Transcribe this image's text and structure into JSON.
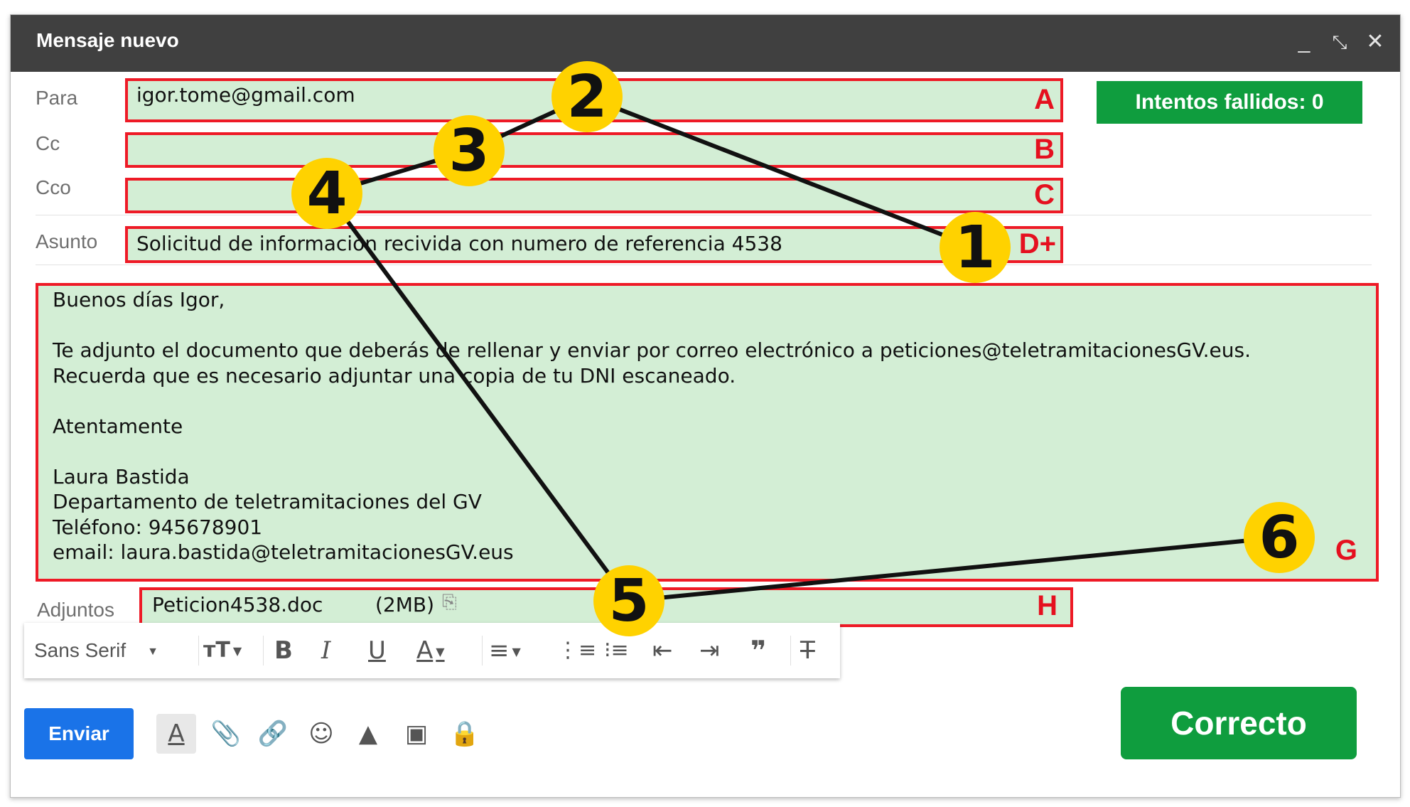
{
  "window": {
    "title": "Mensaje nuevo",
    "controls": {
      "minimize": "_",
      "expand": "⤡",
      "close": "✕"
    }
  },
  "fields": {
    "to": {
      "label": "Para",
      "value": "igor.tome@gmail.com",
      "letter": "A"
    },
    "cc": {
      "label": "Cc",
      "value": "",
      "letter": "B"
    },
    "bcc": {
      "label": "Cco",
      "value": "",
      "letter": "C"
    },
    "subject": {
      "label": "Asunto",
      "value": "Solicitud de informacion recivida con numero de referencia 4538",
      "letter": "D+"
    },
    "attachments": {
      "label": "Adjuntos",
      "file_name": "Peticion4538.doc",
      "file_size": "(2MB)",
      "letter": "H"
    }
  },
  "body": {
    "letter": "G",
    "lines": [
      "Buenos días Igor,",
      "",
      "Te adjunto el documento que deberás de rellenar y enviar por correo electrónico a peticiones@teletramitacionesGV.eus.",
      "Recuerda que es necesario adjuntar una copia de tu DNI escaneado.",
      "",
      "Atentamente",
      "",
      "Laura Bastida",
      "Departamento de teletramitaciones del GV",
      "Teléfono: 945678901",
      "email: laura.bastida@teletramitacionesGV.eus"
    ]
  },
  "status": {
    "failed_attempts": "Intentos fallidos: 0"
  },
  "toolbar": {
    "font": "Sans Serif",
    "icons": [
      "text-size-icon",
      "bold-icon",
      "italic-icon",
      "underline-icon",
      "text-color-icon",
      "align-icon",
      "numbered-list-icon",
      "bulleted-list-icon",
      "indent-less-icon",
      "indent-more-icon",
      "quote-icon",
      "remove-formatting-icon"
    ]
  },
  "bottom": {
    "send_label": "Enviar",
    "correct_label": "Correcto",
    "icons": [
      "format-icon",
      "attach-icon",
      "link-icon",
      "emoji-icon",
      "drive-icon",
      "photo-icon",
      "confidential-icon"
    ]
  },
  "overlay": {
    "markers": [
      "1",
      "2",
      "3",
      "4",
      "5",
      "6"
    ],
    "marker_color": "#ffd200",
    "box_color": "#ee1a26",
    "field_fill": "#d3eed5"
  }
}
